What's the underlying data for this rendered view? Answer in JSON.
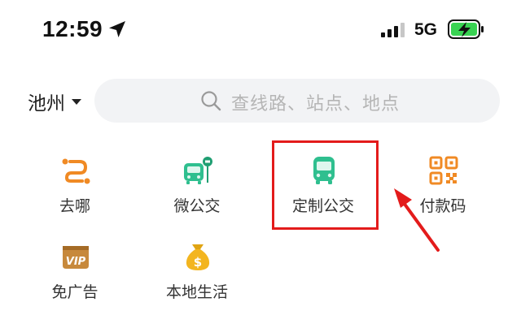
{
  "status_bar": {
    "time": "12:59",
    "network": "5G",
    "location_icon": "location-arrow-icon",
    "signal_icon": "cellular-signal-icon",
    "battery_icon": "battery-charging-icon"
  },
  "header": {
    "city": "池州",
    "search_placeholder": "查线路、站点、地点"
  },
  "grid": [
    {
      "label": "去哪",
      "icon": "route-icon",
      "color": "#f08a24"
    },
    {
      "label": "微公交",
      "icon": "mini-bus-stop-icon",
      "color": "#2fbf8f"
    },
    {
      "label": "定制公交",
      "icon": "bus-icon",
      "color": "#2fbf8f"
    },
    {
      "label": "付款码",
      "icon": "qr-code-icon",
      "color": "#f08a24"
    },
    {
      "label": "免广告",
      "icon": "vip-badge-icon",
      "color": "#c7893c"
    },
    {
      "label": "本地生活",
      "icon": "money-bag-icon",
      "color": "#f3b51f"
    }
  ],
  "annotation": {
    "highlight_color": "#e31b1b",
    "highlighted_item": "定制公交"
  }
}
